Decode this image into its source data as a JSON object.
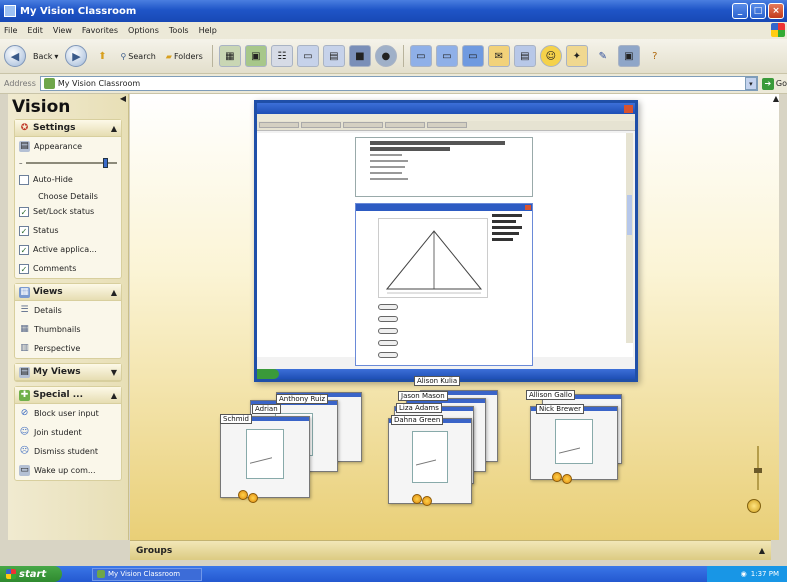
{
  "window": {
    "title": "My Vision Classroom",
    "buttons": [
      "_",
      "□",
      "×"
    ]
  },
  "menu": [
    "File",
    "Edit",
    "View",
    "Favorites",
    "Options",
    "Tools",
    "Help"
  ],
  "toolbar": {
    "back_label": "Back",
    "search_label": "Search",
    "folders_label": "Folders"
  },
  "address": {
    "label": "Address",
    "value": "My Vision Classroom",
    "go_label": "Go"
  },
  "sidebar": {
    "app_title": "Vision",
    "settings": {
      "title": "Settings",
      "appearance": "Appearance",
      "auto_hide": "Auto-Hide",
      "choose_details": "Choose Details",
      "details": [
        {
          "label": "Set/Lock status",
          "checked": true
        },
        {
          "label": "Status",
          "checked": true
        },
        {
          "label": "Active applica...",
          "checked": true
        },
        {
          "label": "Comments",
          "checked": true
        }
      ],
      "slider_level": 0.85
    },
    "views": {
      "title": "Views",
      "items": [
        "Details",
        "Thumbnails",
        "Perspective"
      ]
    },
    "my_views": {
      "title": "My Views"
    },
    "special": {
      "title": "Special ...",
      "items": [
        "Block user input",
        "Join student",
        "Dismiss student",
        "Wake up com..."
      ]
    }
  },
  "students": {
    "group1": [
      "Anthony Ruiz",
      "Adrian",
      "Schmid"
    ],
    "group2": [
      "Alison Kulia",
      "Jason Mason",
      "Liza Adams",
      "Dahna Green"
    ],
    "group3": [
      "Allison Gallo",
      "Nick Brewer"
    ]
  },
  "groups_panel": {
    "title": "Groups"
  },
  "taskbar": {
    "start": "start",
    "task": "My Vision Classroom",
    "clock": "1:37 PM"
  }
}
